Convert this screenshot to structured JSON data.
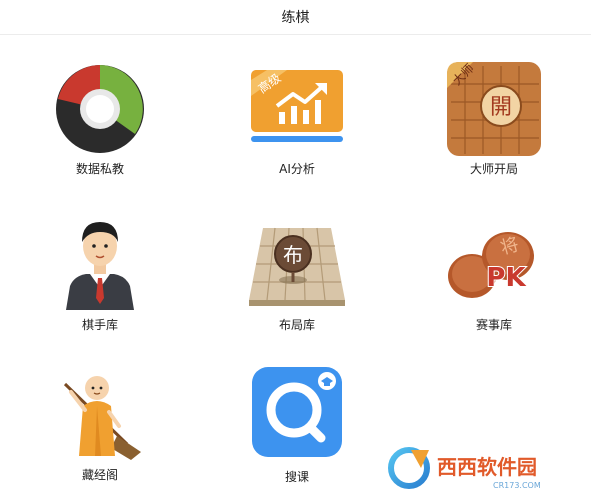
{
  "header": {
    "title": "练棋"
  },
  "tiles": [
    {
      "label": "数据私教",
      "icon": "data-coach-pie-icon"
    },
    {
      "label": "AI分析",
      "icon": "ai-analysis-chart-icon",
      "badge": "高级"
    },
    {
      "label": "大师开局",
      "icon": "master-opening-board-icon",
      "badge": "大师",
      "piece_char": "開"
    },
    {
      "label": "棋手库",
      "icon": "player-avatar-icon"
    },
    {
      "label": "布局库",
      "icon": "layout-board-icon",
      "piece_char": "布"
    },
    {
      "label": "赛事库",
      "icon": "tournament-pk-icon",
      "badge": "PK",
      "piece_char": "将"
    },
    {
      "label": "藏经阁",
      "icon": "monk-sweeping-icon"
    },
    {
      "label": "搜课",
      "icon": "search-course-icon"
    }
  ],
  "watermark": {
    "text": "西西软件园",
    "sub": "CR173.COM"
  },
  "colors": {
    "orange": "#f0a030",
    "green": "#77b13f",
    "red": "#c9392e",
    "blue": "#3d93ef",
    "wood": "#c47a3d",
    "board": "#d8c5a8"
  }
}
